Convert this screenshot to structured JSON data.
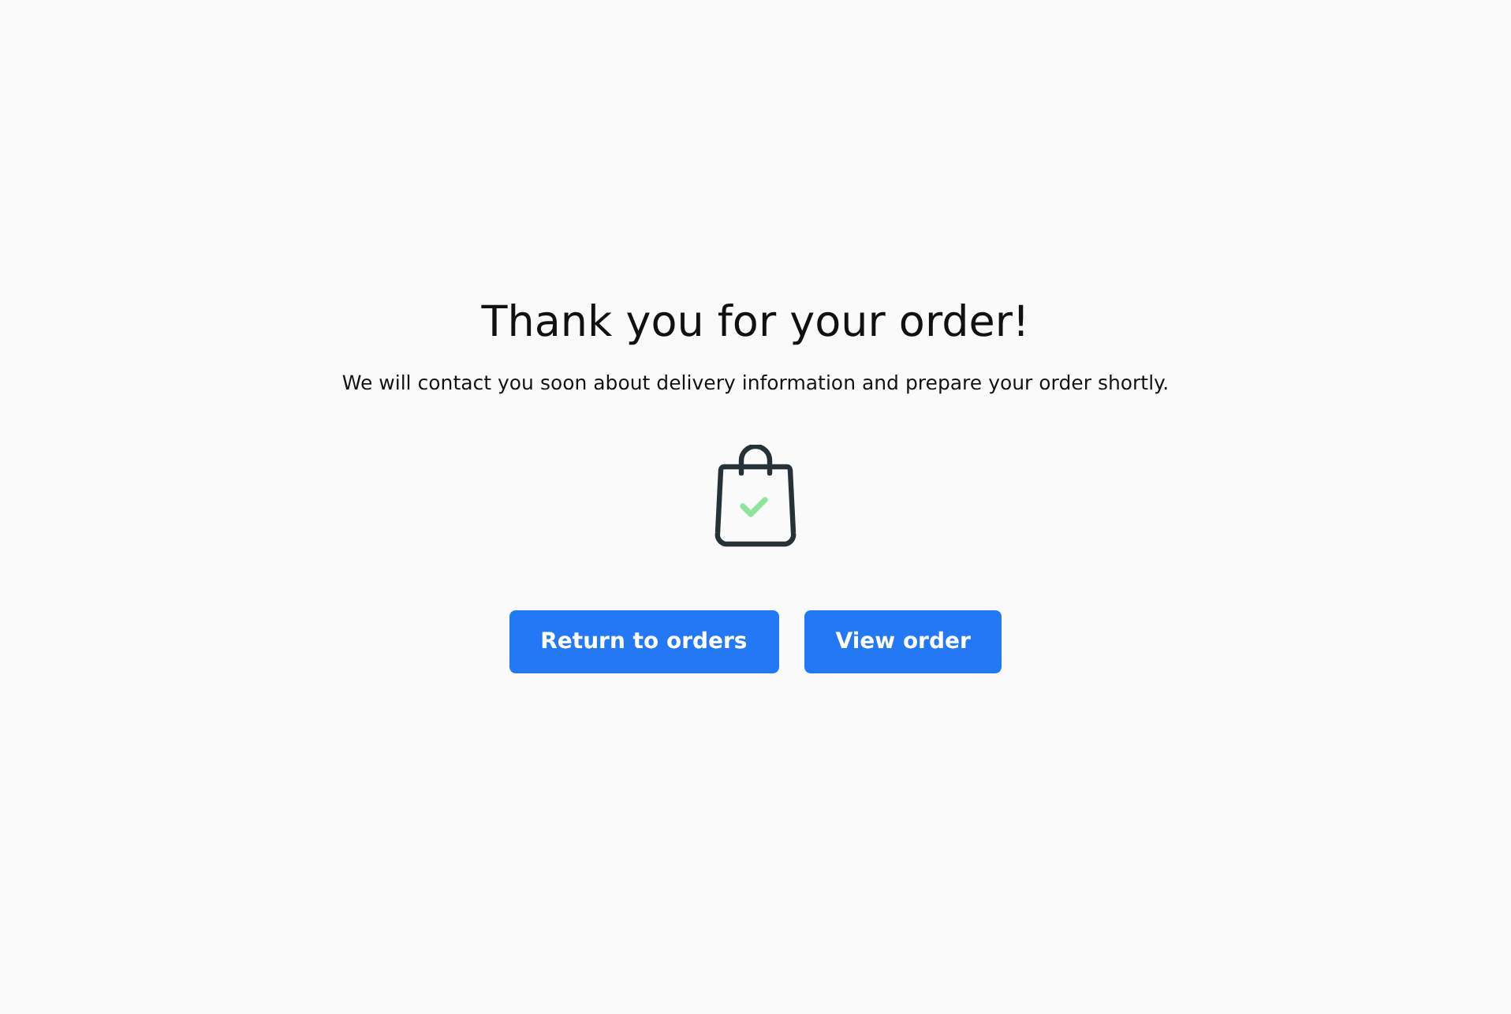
{
  "title": "Thank you for your order!",
  "message": "We will contact you soon about delivery information and prepare your order shortly.",
  "buttons": [
    {
      "label": "Return to orders"
    },
    {
      "label": "View order"
    }
  ]
}
